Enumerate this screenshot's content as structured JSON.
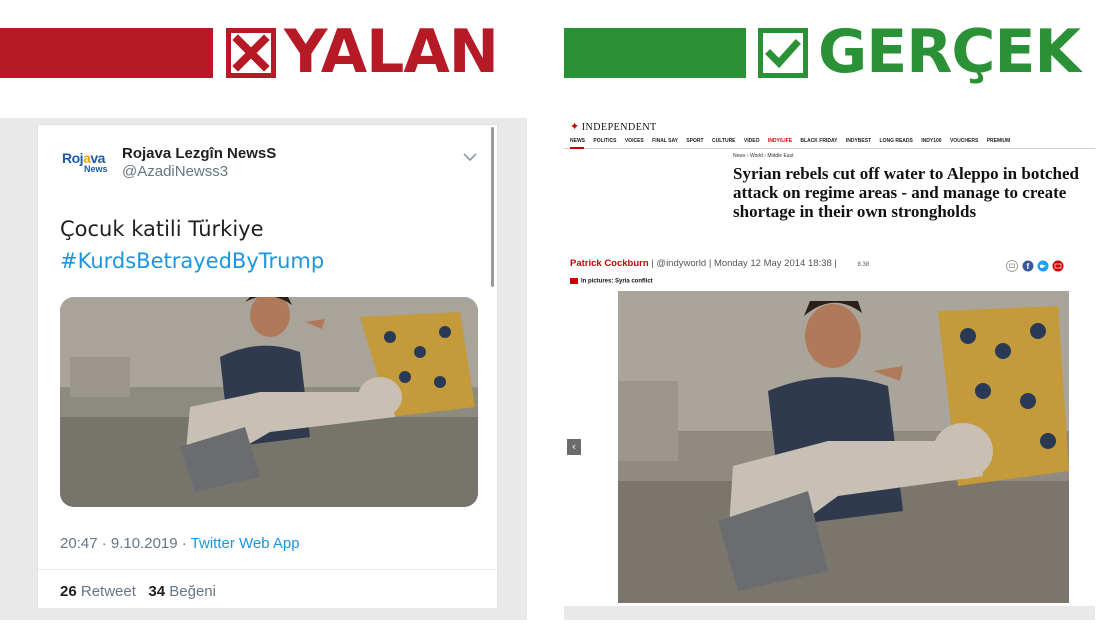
{
  "banners": {
    "false_label": "YALAN",
    "true_label": "GERÇEK",
    "colors": {
      "false_red": "#b71a27",
      "true_green": "#2b9137"
    },
    "false_icon": "x-icon",
    "true_icon": "checkmark-icon"
  },
  "tweet": {
    "logo": {
      "main": "Rojava",
      "sub": "News",
      "accent": "#f2a30f"
    },
    "account_name": "Rojava Lezgîn NewsS",
    "handle": "@AzadiNewss3",
    "menu_icon": "chevron-down-icon",
    "text": "Çocuk katili Türkiye",
    "hashtag": "#KurdsBetrayedByTrump",
    "time": "20:47 · 9.10.2019 · ",
    "source": "Twitter Web App",
    "retweets": "26",
    "retweet_label": "Retweet",
    "likes": "34",
    "like_label": "Beğeni",
    "photo_icon": "photo-man-holding-child"
  },
  "article": {
    "publication": "INDEPENDENT",
    "nav": [
      "NEWS",
      "POLITICS",
      "VOICES",
      "FINAL SAY",
      "SPORT",
      "CULTURE",
      "VIDEO",
      "INDY/LIFE",
      "BLACK FRIDAY",
      "INDYBEST",
      "LONG READS",
      "INDY100",
      "VOUCHERS",
      "PREMIUM"
    ],
    "breadcrumb": "News › World › Middle East",
    "headline": "Syrian rebels cut off water to Aleppo in botched attack on regime areas - and manage to create shortage in their own strongholds",
    "author": "Patrick Cockburn",
    "handle": "@indyworld",
    "date": "Monday 12 May 2014 18:38",
    "share_count": "8.38",
    "share_icons": [
      "comment-icon",
      "facebook-icon",
      "twitter-icon",
      "email-icon"
    ],
    "in_pictures": "In pictures: Syria conflict",
    "prev_label": "‹",
    "photo_icon": "photo-man-holding-child"
  }
}
